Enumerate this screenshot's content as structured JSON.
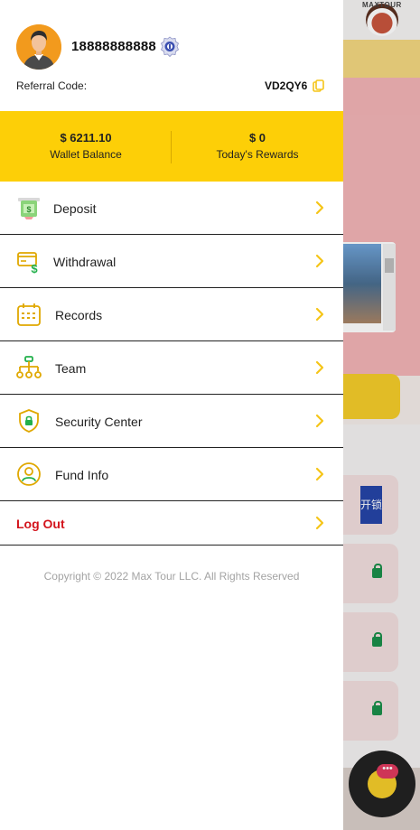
{
  "profile": {
    "phone": "18888888888",
    "referral_label": "Referral Code:",
    "referral_code": "VD2QY6"
  },
  "stats": {
    "wallet_amount": "$ 6211.10",
    "wallet_label": "Wallet Balance",
    "rewards_amount": "$ 0",
    "rewards_label": "Today's Rewards"
  },
  "menu": [
    {
      "label": "Deposit",
      "icon": "deposit-icon"
    },
    {
      "label": "Withdrawal",
      "icon": "withdrawal-icon"
    },
    {
      "label": "Records",
      "icon": "calendar-icon"
    },
    {
      "label": "Team",
      "icon": "team-hierarchy-icon"
    },
    {
      "label": "Security Center",
      "icon": "shield-lock-icon"
    },
    {
      "label": "Fund Info",
      "icon": "user-circle-icon"
    }
  ],
  "logout_label": "Log Out",
  "copyright": "Copyright © 2022 Max Tour LLC. All Rights Reserved",
  "background": {
    "logo_text": "MAXTOUR",
    "chip_text": "开锁"
  },
  "colors": {
    "accent_yellow": "#fdcf07",
    "logout_red": "#d3141c",
    "chevron_yellow": "#f5c518"
  }
}
